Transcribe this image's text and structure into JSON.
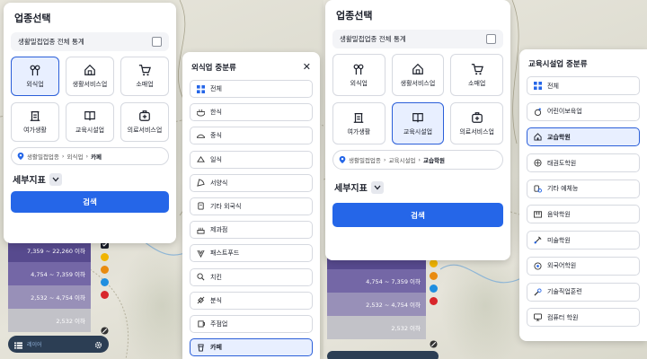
{
  "left": {
    "panel": {
      "title": "업종선택",
      "stat_label": "생활밀접업종 전체 통계",
      "tiles": [
        {
          "label": "외식업",
          "icon": "utensils-icon",
          "active": true
        },
        {
          "label": "생활서비스업",
          "icon": "house-icon",
          "active": false
        },
        {
          "label": "소매업",
          "icon": "cart-icon",
          "active": false
        },
        {
          "label": "여가생활",
          "icon": "leisure-icon",
          "active": false
        },
        {
          "label": "교육시설업",
          "icon": "book-icon",
          "active": false
        },
        {
          "label": "의료서비스업",
          "icon": "medical-icon",
          "active": false
        }
      ],
      "breadcrumb": {
        "root": "생활밀접업종",
        "mid": "외식업",
        "current": "카페"
      },
      "detail_label": "세부지표",
      "search_label": "검색"
    },
    "legend": [
      {
        "label": "7,359 ~ 22,260 이하",
        "color": "#574a8e"
      },
      {
        "label": "4,754 ~ 7,359 이하",
        "color": "#7467a6"
      },
      {
        "label": "2,532 ~ 4,754 이하",
        "color": "#9890b8"
      },
      {
        "label": "2,532 이하",
        "color": "#c2c2c8"
      }
    ],
    "dots": [
      "#f0b400",
      "#e98b10",
      "#1f8ee0",
      "#d8262b"
    ],
    "toolbar_text": "레이어",
    "sub": {
      "title": "외식업 중분류",
      "items": [
        {
          "label": "전체",
          "icon": "grid-icon",
          "active": false
        },
        {
          "label": "한식",
          "icon": "bowl-icon",
          "active": false
        },
        {
          "label": "중식",
          "icon": "dumpling-icon",
          "active": false
        },
        {
          "label": "일식",
          "icon": "sushi-icon",
          "active": false
        },
        {
          "label": "서양식",
          "icon": "pizza-icon",
          "active": false
        },
        {
          "label": "기타 외국식",
          "icon": "jar-icon",
          "active": false
        },
        {
          "label": "제과점",
          "icon": "cake-icon",
          "active": false
        },
        {
          "label": "패스트푸드",
          "icon": "fastfood-icon",
          "active": false
        },
        {
          "label": "치킨",
          "icon": "chicken-icon",
          "active": false
        },
        {
          "label": "분식",
          "icon": "snack-icon",
          "active": false
        },
        {
          "label": "주점업",
          "icon": "beer-icon",
          "active": false
        },
        {
          "label": "카페",
          "icon": "cup-icon",
          "active": true
        }
      ]
    }
  },
  "right": {
    "panel": {
      "title": "업종선택",
      "stat_label": "생활밀접업종 전체 통계",
      "tiles": [
        {
          "label": "외식업",
          "icon": "utensils-icon",
          "active": false
        },
        {
          "label": "생활서비스업",
          "icon": "house-icon",
          "active": false
        },
        {
          "label": "소매업",
          "icon": "cart-icon",
          "active": false
        },
        {
          "label": "여가생활",
          "icon": "leisure-icon",
          "active": false
        },
        {
          "label": "교육시설업",
          "icon": "book-icon",
          "active": true
        },
        {
          "label": "의료서비스업",
          "icon": "medical-icon",
          "active": false
        }
      ],
      "breadcrumb": {
        "root": "생활밀접업종",
        "mid": "교육시설업",
        "current": "교습학원"
      },
      "detail_label": "세부지표",
      "search_label": "검색"
    },
    "legend": [
      {
        "label": "4,754 ~ 7,359 이하",
        "color": "#7467a6"
      },
      {
        "label": "2,532 ~ 4,754 이하",
        "color": "#9890b8"
      },
      {
        "label": "2,532 이하",
        "color": "#c2c2c8"
      }
    ],
    "dots": [
      "#f0b400",
      "#e98b10",
      "#1f8ee0",
      "#d8262b"
    ],
    "sub": {
      "title": "교육시설업 중분류",
      "items": [
        {
          "label": "전체",
          "icon": "grid-icon",
          "active": false
        },
        {
          "label": "어린이보육업",
          "icon": "child-icon",
          "active": false
        },
        {
          "label": "교습학원",
          "icon": "academy-icon",
          "active": true
        },
        {
          "label": "태권도학원",
          "icon": "taekwondo-icon",
          "active": false
        },
        {
          "label": "기타 예체능",
          "icon": "arts-icon",
          "active": false
        },
        {
          "label": "음악학원",
          "icon": "piano-icon",
          "active": false
        },
        {
          "label": "미술학원",
          "icon": "brush-icon",
          "active": false
        },
        {
          "label": "외국어학원",
          "icon": "language-icon",
          "active": false
        },
        {
          "label": "기술직업훈련",
          "icon": "wrench-icon",
          "active": false
        },
        {
          "label": "컴퓨터 학원",
          "icon": "computer-icon",
          "active": false
        }
      ]
    }
  }
}
